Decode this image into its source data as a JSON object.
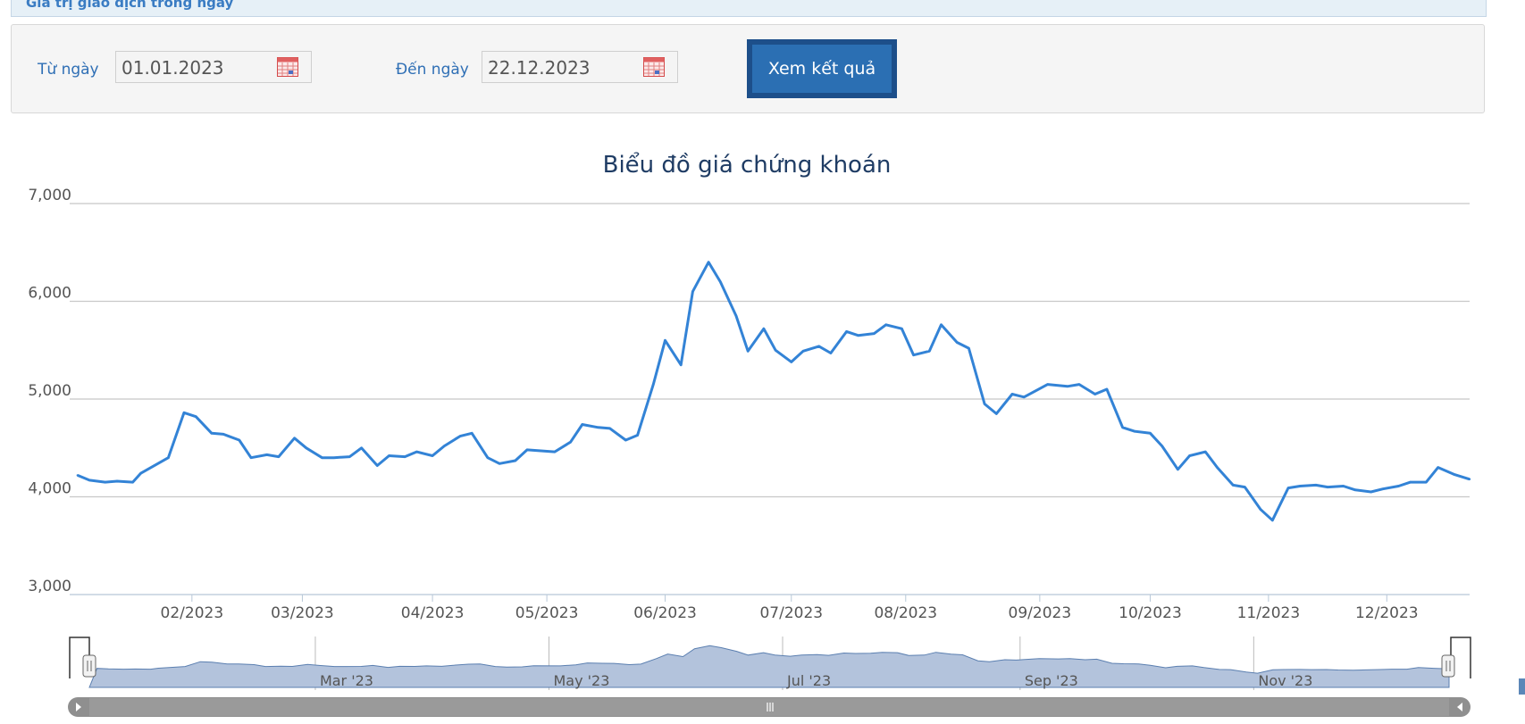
{
  "header": {
    "section_title": "Giá trị giao dịch trong ngày"
  },
  "filter": {
    "from_label": "Từ ngày",
    "from_value": "01.01.2023",
    "to_label": "Đến ngày",
    "to_value": "22.12.2023",
    "submit_label": "Xem kết quả"
  },
  "colors": {
    "line": "#3383d6",
    "accent": "#2b6fb3",
    "navigator_fill": "#b3c3dc",
    "grid": "#c8c8c8"
  },
  "icons": {
    "date_picker": "calendar-icon"
  },
  "chart_data": {
    "type": "line",
    "title": "Biểu đồ giá chứng khoán",
    "xlabel": "",
    "ylabel": "",
    "ylim": [
      3000,
      7000
    ],
    "yticks": [
      "3,000",
      "4,000",
      "5,000",
      "6,000",
      "7,000"
    ],
    "grid": true,
    "legend": "none",
    "x_range": [
      "2023-01-01",
      "2023-12-22"
    ],
    "xtick_labels": [
      {
        "date": "2023-02-01",
        "label": "02/2023"
      },
      {
        "date": "2023-03-01",
        "label": "03/2023"
      },
      {
        "date": "2023-04-03",
        "label": "04/2023"
      },
      {
        "date": "2023-05-02",
        "label": "05/2023"
      },
      {
        "date": "2023-06-01",
        "label": "06/2023"
      },
      {
        "date": "2023-07-03",
        "label": "07/2023"
      },
      {
        "date": "2023-08-01",
        "label": "08/2023"
      },
      {
        "date": "2023-09-04",
        "label": "09/2023"
      },
      {
        "date": "2023-10-02",
        "label": "10/2023"
      },
      {
        "date": "2023-11-01",
        "label": "11/2023"
      },
      {
        "date": "2023-12-01",
        "label": "12/2023"
      }
    ],
    "navigator_labels": [
      {
        "date": "2023-03-01",
        "label": "Mar '23"
      },
      {
        "date": "2023-05-01",
        "label": "May '23"
      },
      {
        "date": "2023-07-01",
        "label": "Jul '23"
      },
      {
        "date": "2023-09-01",
        "label": "Sep '23"
      },
      {
        "date": "2023-11-01",
        "label": "Nov '23"
      }
    ],
    "series": [
      {
        "x": [
          "2023-01-03",
          "2023-01-06",
          "2023-01-10",
          "2023-01-13",
          "2023-01-17",
          "2023-01-19",
          "2023-01-26",
          "2023-01-30",
          "2023-02-02",
          "2023-02-06",
          "2023-02-09",
          "2023-02-13",
          "2023-02-16",
          "2023-02-20",
          "2023-02-23",
          "2023-02-27",
          "2023-03-02",
          "2023-03-06",
          "2023-03-09",
          "2023-03-13",
          "2023-03-16",
          "2023-03-20",
          "2023-03-23",
          "2023-03-27",
          "2023-03-30",
          "2023-04-03",
          "2023-04-06",
          "2023-04-10",
          "2023-04-13",
          "2023-04-17",
          "2023-04-20",
          "2023-04-24",
          "2023-04-27",
          "2023-05-04",
          "2023-05-08",
          "2023-05-11",
          "2023-05-15",
          "2023-05-18",
          "2023-05-22",
          "2023-05-25",
          "2023-05-29",
          "2023-06-01",
          "2023-06-05",
          "2023-06-08",
          "2023-06-12",
          "2023-06-15",
          "2023-06-19",
          "2023-06-22",
          "2023-06-26",
          "2023-06-29",
          "2023-07-03",
          "2023-07-06",
          "2023-07-10",
          "2023-07-13",
          "2023-07-17",
          "2023-07-20",
          "2023-07-24",
          "2023-07-27",
          "2023-07-31",
          "2023-08-03",
          "2023-08-07",
          "2023-08-10",
          "2023-08-14",
          "2023-08-17",
          "2023-08-21",
          "2023-08-24",
          "2023-08-28",
          "2023-08-31",
          "2023-09-06",
          "2023-09-11",
          "2023-09-14",
          "2023-09-18",
          "2023-09-21",
          "2023-09-25",
          "2023-09-28",
          "2023-10-02",
          "2023-10-05",
          "2023-10-09",
          "2023-10-12",
          "2023-10-16",
          "2023-10-19",
          "2023-10-23",
          "2023-10-26",
          "2023-10-30",
          "2023-11-02",
          "2023-11-06",
          "2023-11-09",
          "2023-11-13",
          "2023-11-16",
          "2023-11-20",
          "2023-11-23",
          "2023-11-27",
          "2023-11-30",
          "2023-12-04",
          "2023-12-07",
          "2023-12-11",
          "2023-12-14",
          "2023-12-18",
          "2023-12-22"
        ],
        "values": [
          4220,
          4170,
          4150,
          4160,
          4150,
          4240,
          4400,
          4860,
          4820,
          4650,
          4640,
          4580,
          4400,
          4430,
          4410,
          4600,
          4500,
          4400,
          4400,
          4410,
          4500,
          4320,
          4420,
          4410,
          4460,
          4420,
          4520,
          4620,
          4650,
          4400,
          4340,
          4370,
          4480,
          4460,
          4560,
          4740,
          4710,
          4700,
          4580,
          4630,
          5150,
          5600,
          5350,
          6100,
          6400,
          6200,
          5850,
          5490,
          5720,
          5500,
          5380,
          5490,
          5540,
          5470,
          5690,
          5650,
          5670,
          5760,
          5720,
          5450,
          5490,
          5760,
          5580,
          5520,
          4950,
          4850,
          5050,
          5020,
          5150,
          5130,
          5150,
          5050,
          5100,
          4710,
          4670,
          4650,
          4520,
          4280,
          4420,
          4460,
          4300,
          4120,
          4100,
          3870,
          3760,
          4090,
          4110,
          4120,
          4100,
          4110,
          4070,
          4050,
          4080,
          4110,
          4150,
          4150,
          4300,
          4230,
          4180
        ]
      }
    ]
  }
}
